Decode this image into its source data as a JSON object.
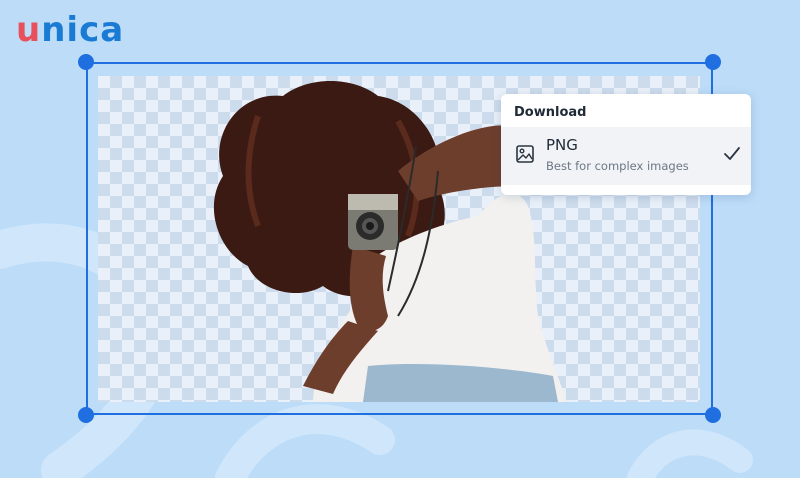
{
  "logo": {
    "first_letter": "u",
    "rest": "nica",
    "colors": {
      "u": "#e8505b",
      "nica": "#1a7bd4"
    }
  },
  "canvas": {
    "background": "transparent-checkerboard",
    "selection_color": "#1f6fe0"
  },
  "download_menu": {
    "title": "Download",
    "option": {
      "icon": "image-icon",
      "name": "PNG",
      "description": "Best for complex images",
      "selected": true,
      "selected_icon": "checkmark-icon"
    }
  }
}
